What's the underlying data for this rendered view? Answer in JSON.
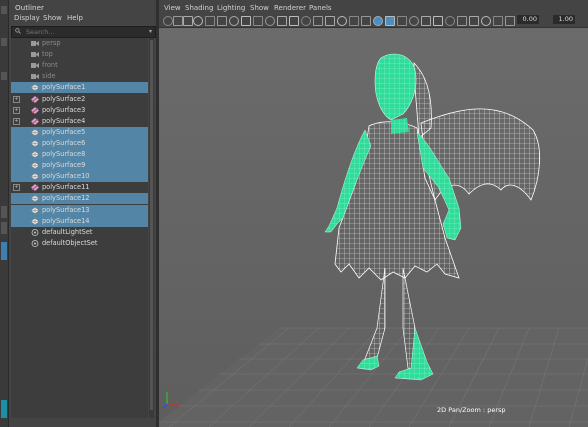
{
  "outliner": {
    "title": "Outliner",
    "menu": [
      "Display",
      "Show",
      "Help"
    ],
    "search": {
      "placeholder": "Search..."
    },
    "items": [
      {
        "label": "persp",
        "icon": "camera-icon",
        "selected": false,
        "expandable": false,
        "dim": true
      },
      {
        "label": "top",
        "icon": "camera-icon",
        "selected": false,
        "expandable": false,
        "dim": true
      },
      {
        "label": "front",
        "icon": "camera-icon",
        "selected": false,
        "expandable": false,
        "dim": true
      },
      {
        "label": "side",
        "icon": "camera-icon",
        "selected": false,
        "expandable": false,
        "dim": true
      },
      {
        "label": "polySurface1",
        "icon": "mesh-icon",
        "selected": true,
        "expandable": false,
        "dim": false
      },
      {
        "label": "polySurface2",
        "icon": "group-icon",
        "selected": false,
        "expandable": true,
        "dim": false
      },
      {
        "label": "polySurface3",
        "icon": "group-icon",
        "selected": false,
        "expandable": true,
        "dim": false
      },
      {
        "label": "polySurface4",
        "icon": "group-icon",
        "selected": false,
        "expandable": true,
        "dim": false
      },
      {
        "label": "polySurface5",
        "icon": "mesh-icon",
        "selected": true,
        "expandable": false,
        "dim": false
      },
      {
        "label": "polySurface6",
        "icon": "mesh-icon",
        "selected": true,
        "expandable": false,
        "dim": false
      },
      {
        "label": "polySurface8",
        "icon": "mesh-icon",
        "selected": true,
        "expandable": false,
        "dim": false
      },
      {
        "label": "polySurface9",
        "icon": "mesh-icon",
        "selected": true,
        "expandable": false,
        "dim": false
      },
      {
        "label": "polySurface10",
        "icon": "mesh-icon",
        "selected": true,
        "expandable": false,
        "dim": false
      },
      {
        "label": "polySurface11",
        "icon": "group-icon",
        "selected": false,
        "expandable": true,
        "dim": false
      },
      {
        "label": "polySurface12",
        "icon": "mesh-icon",
        "selected": true,
        "expandable": false,
        "dim": false
      },
      {
        "label": "polySurface13",
        "icon": "mesh-icon",
        "selected": true,
        "expandable": false,
        "dim": false
      },
      {
        "label": "polySurface14",
        "icon": "mesh-icon",
        "selected": true,
        "expandable": false,
        "dim": false
      },
      {
        "label": "defaultLightSet",
        "icon": "set-icon",
        "selected": false,
        "expandable": false,
        "dim": false
      },
      {
        "label": "defaultObjectSet",
        "icon": "set-icon",
        "selected": false,
        "expandable": false,
        "dim": false
      }
    ]
  },
  "viewport": {
    "menu": [
      "View",
      "Shading",
      "Lighting",
      "Show",
      "Renderer",
      "Panels"
    ],
    "fields": {
      "exposure": "0.00",
      "gamma": "1.00"
    },
    "label": "2D Pan/Zoom : persp",
    "colors": {
      "selection": "#2fdc9a",
      "wire": "#ffffff",
      "background": "#676767",
      "outliner_selection": "#5285a6"
    }
  }
}
